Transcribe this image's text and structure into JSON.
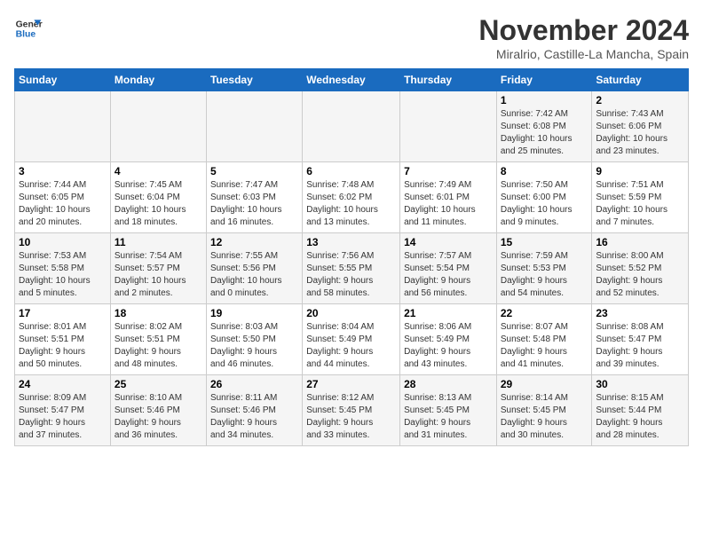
{
  "logo": {
    "line1": "General",
    "line2": "Blue"
  },
  "title": "November 2024",
  "location": "Miralrio, Castille-La Mancha, Spain",
  "weekdays": [
    "Sunday",
    "Monday",
    "Tuesday",
    "Wednesday",
    "Thursday",
    "Friday",
    "Saturday"
  ],
  "weeks": [
    [
      {
        "day": "",
        "info": ""
      },
      {
        "day": "",
        "info": ""
      },
      {
        "day": "",
        "info": ""
      },
      {
        "day": "",
        "info": ""
      },
      {
        "day": "",
        "info": ""
      },
      {
        "day": "1",
        "info": "Sunrise: 7:42 AM\nSunset: 6:08 PM\nDaylight: 10 hours\nand 25 minutes."
      },
      {
        "day": "2",
        "info": "Sunrise: 7:43 AM\nSunset: 6:06 PM\nDaylight: 10 hours\nand 23 minutes."
      }
    ],
    [
      {
        "day": "3",
        "info": "Sunrise: 7:44 AM\nSunset: 6:05 PM\nDaylight: 10 hours\nand 20 minutes."
      },
      {
        "day": "4",
        "info": "Sunrise: 7:45 AM\nSunset: 6:04 PM\nDaylight: 10 hours\nand 18 minutes."
      },
      {
        "day": "5",
        "info": "Sunrise: 7:47 AM\nSunset: 6:03 PM\nDaylight: 10 hours\nand 16 minutes."
      },
      {
        "day": "6",
        "info": "Sunrise: 7:48 AM\nSunset: 6:02 PM\nDaylight: 10 hours\nand 13 minutes."
      },
      {
        "day": "7",
        "info": "Sunrise: 7:49 AM\nSunset: 6:01 PM\nDaylight: 10 hours\nand 11 minutes."
      },
      {
        "day": "8",
        "info": "Sunrise: 7:50 AM\nSunset: 6:00 PM\nDaylight: 10 hours\nand 9 minutes."
      },
      {
        "day": "9",
        "info": "Sunrise: 7:51 AM\nSunset: 5:59 PM\nDaylight: 10 hours\nand 7 minutes."
      }
    ],
    [
      {
        "day": "10",
        "info": "Sunrise: 7:53 AM\nSunset: 5:58 PM\nDaylight: 10 hours\nand 5 minutes."
      },
      {
        "day": "11",
        "info": "Sunrise: 7:54 AM\nSunset: 5:57 PM\nDaylight: 10 hours\nand 2 minutes."
      },
      {
        "day": "12",
        "info": "Sunrise: 7:55 AM\nSunset: 5:56 PM\nDaylight: 10 hours\nand 0 minutes."
      },
      {
        "day": "13",
        "info": "Sunrise: 7:56 AM\nSunset: 5:55 PM\nDaylight: 9 hours\nand 58 minutes."
      },
      {
        "day": "14",
        "info": "Sunrise: 7:57 AM\nSunset: 5:54 PM\nDaylight: 9 hours\nand 56 minutes."
      },
      {
        "day": "15",
        "info": "Sunrise: 7:59 AM\nSunset: 5:53 PM\nDaylight: 9 hours\nand 54 minutes."
      },
      {
        "day": "16",
        "info": "Sunrise: 8:00 AM\nSunset: 5:52 PM\nDaylight: 9 hours\nand 52 minutes."
      }
    ],
    [
      {
        "day": "17",
        "info": "Sunrise: 8:01 AM\nSunset: 5:51 PM\nDaylight: 9 hours\nand 50 minutes."
      },
      {
        "day": "18",
        "info": "Sunrise: 8:02 AM\nSunset: 5:51 PM\nDaylight: 9 hours\nand 48 minutes."
      },
      {
        "day": "19",
        "info": "Sunrise: 8:03 AM\nSunset: 5:50 PM\nDaylight: 9 hours\nand 46 minutes."
      },
      {
        "day": "20",
        "info": "Sunrise: 8:04 AM\nSunset: 5:49 PM\nDaylight: 9 hours\nand 44 minutes."
      },
      {
        "day": "21",
        "info": "Sunrise: 8:06 AM\nSunset: 5:49 PM\nDaylight: 9 hours\nand 43 minutes."
      },
      {
        "day": "22",
        "info": "Sunrise: 8:07 AM\nSunset: 5:48 PM\nDaylight: 9 hours\nand 41 minutes."
      },
      {
        "day": "23",
        "info": "Sunrise: 8:08 AM\nSunset: 5:47 PM\nDaylight: 9 hours\nand 39 minutes."
      }
    ],
    [
      {
        "day": "24",
        "info": "Sunrise: 8:09 AM\nSunset: 5:47 PM\nDaylight: 9 hours\nand 37 minutes."
      },
      {
        "day": "25",
        "info": "Sunrise: 8:10 AM\nSunset: 5:46 PM\nDaylight: 9 hours\nand 36 minutes."
      },
      {
        "day": "26",
        "info": "Sunrise: 8:11 AM\nSunset: 5:46 PM\nDaylight: 9 hours\nand 34 minutes."
      },
      {
        "day": "27",
        "info": "Sunrise: 8:12 AM\nSunset: 5:45 PM\nDaylight: 9 hours\nand 33 minutes."
      },
      {
        "day": "28",
        "info": "Sunrise: 8:13 AM\nSunset: 5:45 PM\nDaylight: 9 hours\nand 31 minutes."
      },
      {
        "day": "29",
        "info": "Sunrise: 8:14 AM\nSunset: 5:45 PM\nDaylight: 9 hours\nand 30 minutes."
      },
      {
        "day": "30",
        "info": "Sunrise: 8:15 AM\nSunset: 5:44 PM\nDaylight: 9 hours\nand 28 minutes."
      }
    ]
  ]
}
